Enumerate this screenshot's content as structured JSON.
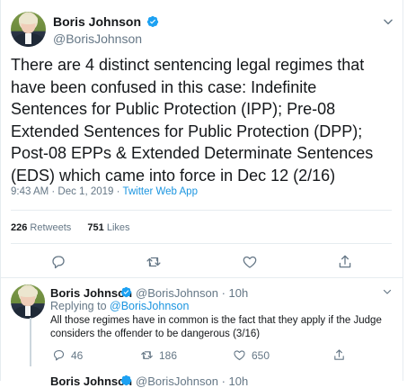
{
  "main_tweet": {
    "author_name": "Boris Johnson",
    "author_handle": "@BorisJohnson",
    "text": "There are 4 distinct sentencing legal regimes that have been confused in this case: Indefinite Sentences for Public Protection (IPP); Pre-08 Extended Sentences for Public Protection (DPP); Post-08 EPPs & Extended Determinate Sentences (EDS) which came into force in Dec 12 (2/16)",
    "time": "9:43 AM · Dec 1, 2019 · ",
    "source": "Twitter Web App",
    "retweets_count": "226",
    "retweets_label": "Retweets",
    "likes_count": "751",
    "likes_label": "Likes"
  },
  "reply_tweet": {
    "author_name": "Boris Johnson",
    "author_handle": "@BorisJohnson · 10h",
    "replying_prefix": "Replying to ",
    "replying_handle": "@BorisJohnson",
    "text": "All those regimes have in common is the fact that they apply if the Judge considers the offender to be dangerous (3/16)",
    "reply_count": "46",
    "retweet_count": "186",
    "like_count": "650"
  },
  "next_tweet": {
    "author_name": "Boris Johnson",
    "author_handle": "@BorisJohnson · 10h"
  },
  "icons": {
    "verified": "verified-badge-icon",
    "more": "chevron-down-icon",
    "reply": "reply-icon",
    "retweet": "retweet-icon",
    "like": "heart-icon",
    "share": "share-icon"
  },
  "colors": {
    "accent": "#1b95e0",
    "secondary_text": "#657786",
    "border": "#e6ecf0"
  }
}
